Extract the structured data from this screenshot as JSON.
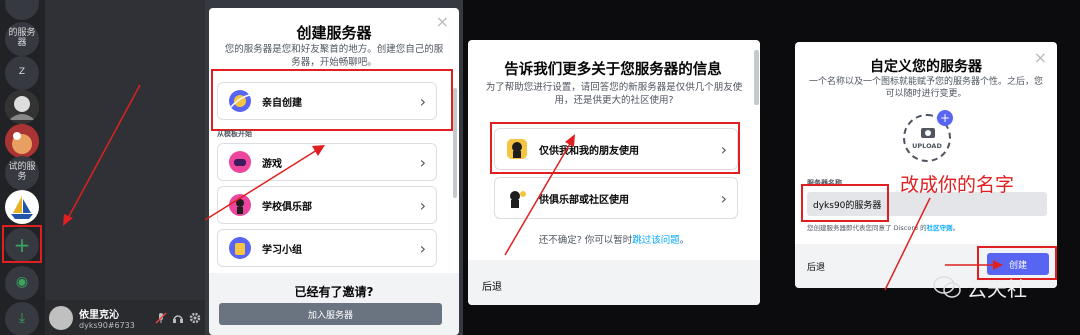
{
  "panel1": {
    "servers": [
      {
        "label": "的服务器"
      },
      {
        "label": "Z"
      },
      {
        "label": ""
      },
      {
        "label": ""
      },
      {
        "label": "试的服务"
      },
      {
        "label": ""
      }
    ],
    "add_server": "+",
    "explore": "◉",
    "download": "⤓",
    "user": {
      "name": "依里克沁",
      "tag": "dyks90#6733"
    },
    "colors": {
      "rail": "#202225",
      "channels": "#2f3136",
      "green": "#3ba55d",
      "red": "#e02020"
    }
  },
  "panel2": {
    "title": "创建服务器",
    "subtitle": "您的服务器是您和好友聚首的地方。创建您自己的服务器，开始畅聊吧。",
    "close": "×",
    "options": [
      {
        "label": "亲自创建"
      },
      {
        "label": "游戏"
      },
      {
        "label": "学校俱乐部"
      },
      {
        "label": "学习小组"
      }
    ],
    "template_header": "从模板开始",
    "invite_title": "已经有了邀请?",
    "join_button": "加入服务器"
  },
  "panel3": {
    "title": "告诉我们更多关于您服务器的信息",
    "subtitle": "为了帮助您进行设置，请回答您的新服务器是仅供几个朋友使用，还是供更大的社区使用?",
    "close": "×",
    "options": [
      {
        "label": "仅供我和我的朋友使用"
      },
      {
        "label": "供俱乐部或社区使用"
      }
    ],
    "unsure": "还不确定? 你可以暂时",
    "skip_link": "跳过该问题",
    "skip_end": "。",
    "back": "后退"
  },
  "panel4": {
    "title": "自定义您的服务器",
    "subtitle": "一个名称以及一个图标就能赋予您的服务器个性。之后，您可以随时进行变更。",
    "close": "×",
    "upload": "UPLOAD",
    "upload_plus": "+",
    "name_label": "服务器名称",
    "name_value": "dyks90的服务器",
    "guideline_prefix": "您创建服务器即代表您同意了 Discord 的",
    "guideline_link": "社区守则",
    "guideline_end": "。",
    "back": "后退",
    "create": "创建",
    "annotation": "改成你的名字"
  },
  "watermark": "云天社"
}
